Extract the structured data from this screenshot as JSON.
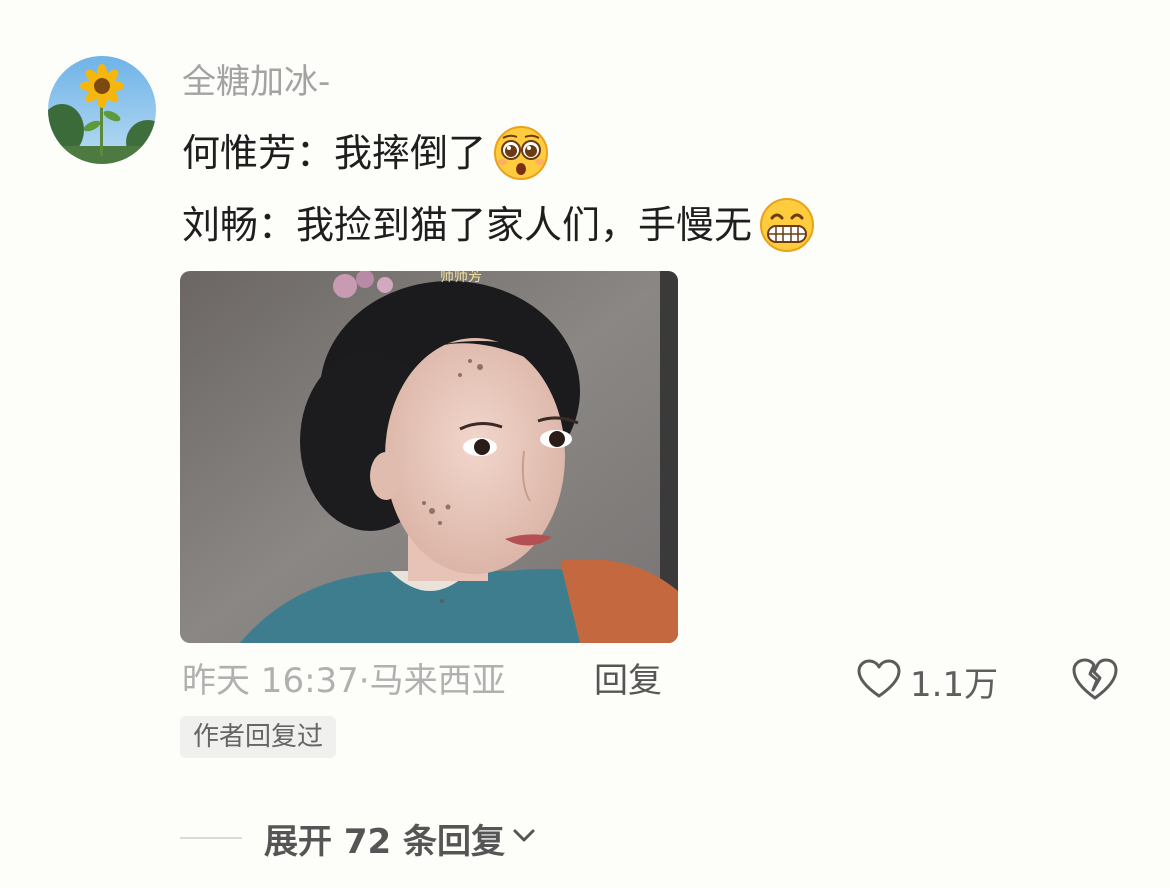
{
  "comment": {
    "username": "全糖加冰-",
    "lines": [
      "何惟芳：我摔倒了",
      "刘畅：我捡到猫了家人们，手慢无"
    ],
    "emojis": [
      "pleading-face-icon",
      "grinning-face-icon"
    ],
    "image_watermark": "师师芳",
    "time": "昨天 16:37",
    "separator": "·",
    "location": "马来西亚",
    "reply_label": "回复",
    "like_count": "1.1万",
    "author_badge": "作者回复过",
    "expand_label": "展开 72 条回复"
  },
  "colors": {
    "background": "#fdfdfa",
    "username": "#a3a3a3",
    "text": "#1e1e1e",
    "meta": "#b0b0b0"
  }
}
